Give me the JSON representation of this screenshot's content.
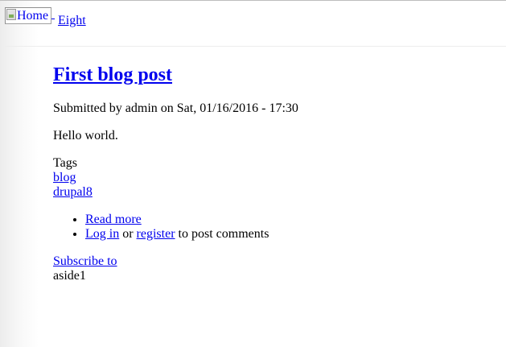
{
  "header": {
    "logo_alt": "Home",
    "site_name": "Eight"
  },
  "article": {
    "title": "First blog post",
    "submitted": "Submitted by admin on Sat, 01/16/2016 - 17:30",
    "body": "Hello world.",
    "tags_label": "Tags",
    "tags": [
      "blog",
      "drupal8"
    ]
  },
  "links": {
    "read_more": "Read more",
    "login": "Log in",
    "or_text": "or",
    "register": "register",
    "post_comments_text": "to post comments"
  },
  "aside": {
    "subscribe": "Subscribe to",
    "label": "aside1"
  }
}
